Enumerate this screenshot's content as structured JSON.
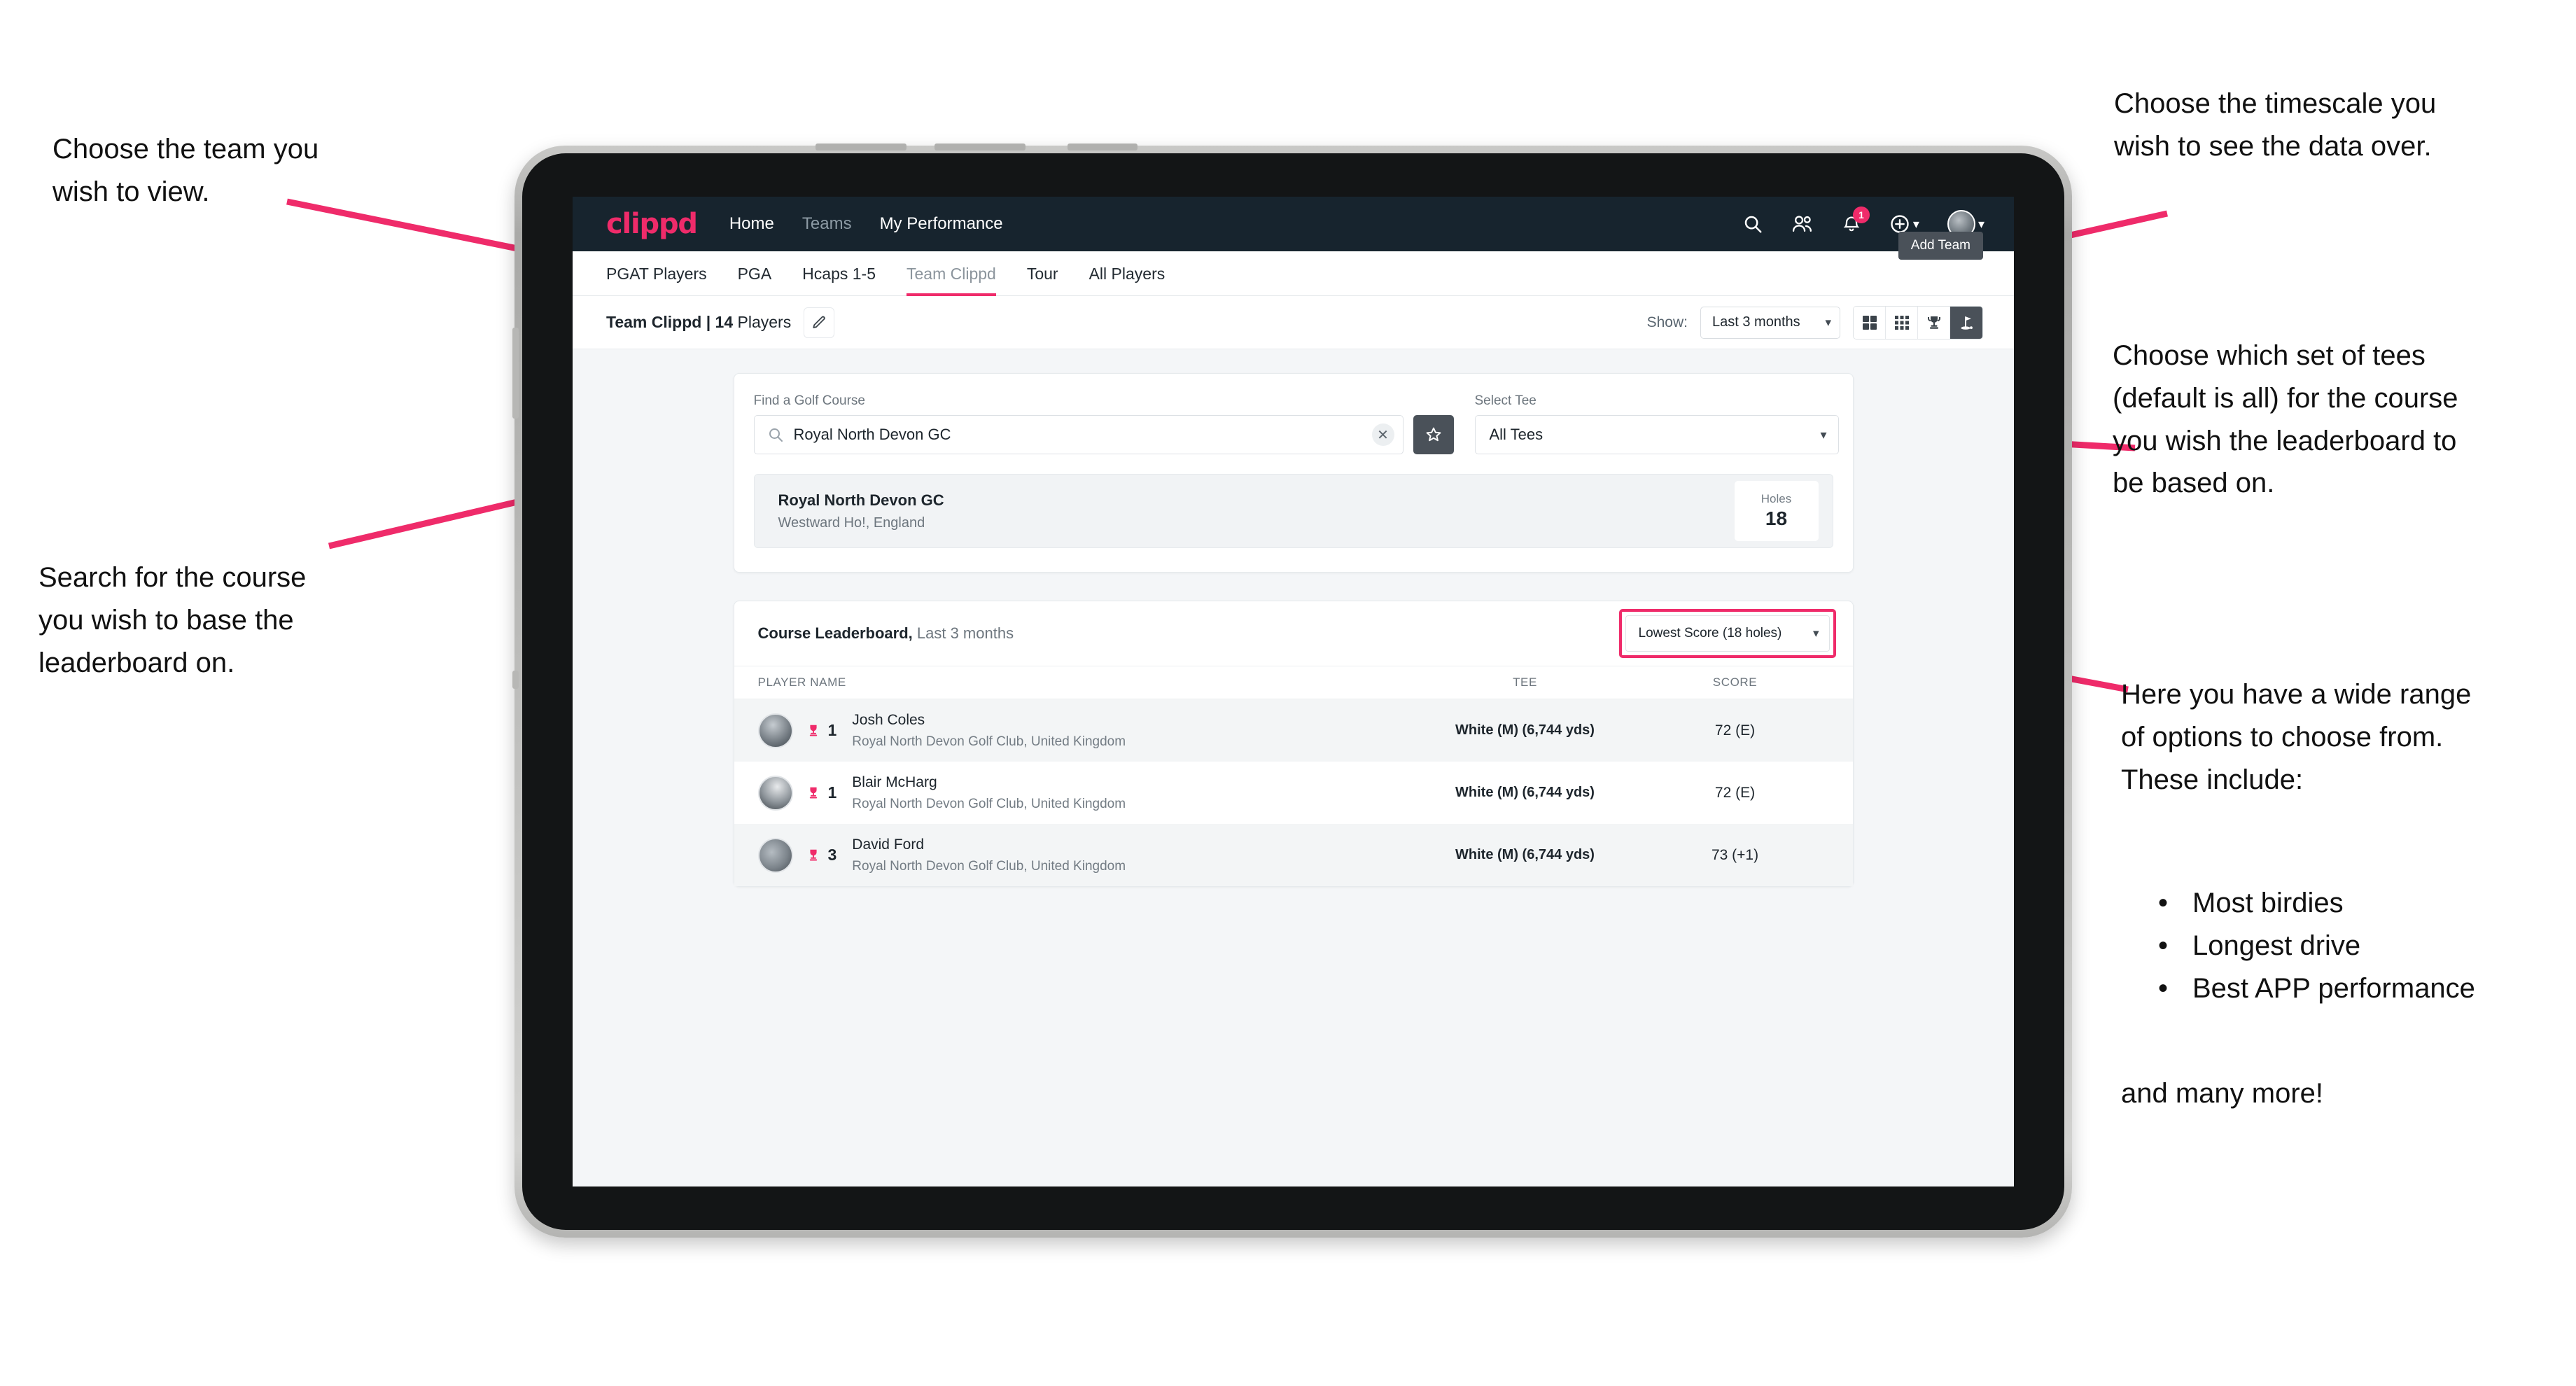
{
  "annotations": {
    "team": "Choose the team you\nwish to view.",
    "timescale": "Choose the timescale you\nwish to see the data over.",
    "tees": "Choose which set of tees\n(default is all) for the course\nyou wish the leaderboard to\nbe based on.",
    "search": "Search for the course\nyou wish to base the\nleaderboard on.",
    "options_intro": "Here you have a wide range\nof options to choose from.\nThese include:",
    "options_list": [
      "Most birdies",
      "Longest drive",
      "Best APP performance"
    ],
    "options_outro": "and many more!"
  },
  "app": {
    "navbar": {
      "logo": "clippd",
      "links": [
        {
          "label": "Home",
          "active": true
        },
        {
          "label": "Teams",
          "active": false
        },
        {
          "label": "My Performance",
          "active": true
        }
      ],
      "icons": [
        "search-icon",
        "people-icon",
        "bell-icon",
        "plus-icon",
        "avatar"
      ],
      "notification_count": "1"
    },
    "tabs": [
      {
        "label": "PGAT Players",
        "active": false
      },
      {
        "label": "PGA",
        "active": false
      },
      {
        "label": "Hcaps 1-5",
        "active": false
      },
      {
        "label": "Team Clippd",
        "active": true
      },
      {
        "label": "Tour",
        "active": false
      },
      {
        "label": "All Players",
        "active": false
      }
    ],
    "tooltip": {
      "add_team": "Add Team"
    },
    "toolbar": {
      "team_name": "Team Clippd",
      "separator": " | ",
      "player_count": "14",
      "players_word": " Players",
      "edit_icon": "pencil-icon",
      "show_label": "Show:",
      "timescale_value": "Last 3 months",
      "view_toggles": [
        {
          "icon": "grid-2x2-icon",
          "active": false
        },
        {
          "icon": "grid-3x3-icon",
          "active": false
        },
        {
          "icon": "trophy-icon",
          "active": false
        },
        {
          "icon": "golf-flag-icon",
          "active": true
        }
      ]
    },
    "search_panel": {
      "course_label": "Find a Golf Course",
      "course_value": "Royal North Devon GC",
      "course_placeholder": "Find a Golf Course",
      "clear_icon": "close-icon",
      "star_icon": "star-icon",
      "tee_label": "Select Tee",
      "tee_value": "All Tees"
    },
    "course_card": {
      "name": "Royal North Devon GC",
      "location": "Westward Ho!, England",
      "holes_label": "Holes",
      "holes_value": "18"
    },
    "leaderboard": {
      "title": "Course Leaderboard,",
      "subtitle": " Last 3 months",
      "sort_value": "Lowest Score (18 holes)",
      "columns": [
        "PLAYER NAME",
        "TEE",
        "SCORE"
      ],
      "rows": [
        {
          "rank": "1",
          "name": "Josh Coles",
          "club": "Royal North Devon Golf Club, United Kingdom",
          "tee": "White (M) (6,744 yds)",
          "score": "72 (E)"
        },
        {
          "rank": "1",
          "name": "Blair McHarg",
          "club": "Royal North Devon Golf Club, United Kingdom",
          "tee": "White (M) (6,744 yds)",
          "score": "72 (E)"
        },
        {
          "rank": "3",
          "name": "David Ford",
          "club": "Royal North Devon Golf Club, United Kingdom",
          "tee": "White (M) (6,744 yds)",
          "score": "73 (+1)"
        }
      ]
    }
  },
  "colors": {
    "accent": "#ef2b6a",
    "navbar": "#17242e",
    "dark_button": "#4a5159",
    "screen_bg": "#f4f6f8"
  }
}
